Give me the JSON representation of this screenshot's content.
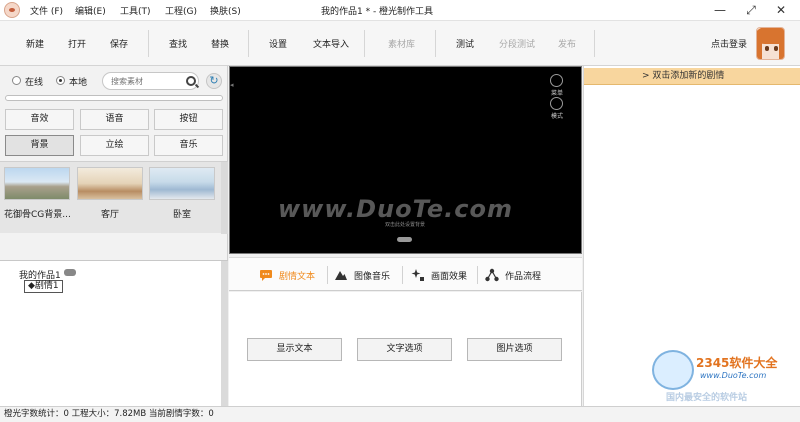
{
  "window": {
    "title": "我的作品1 * - 橙光制作工具",
    "menus": [
      "文件 (F)",
      "编辑(E)",
      "工具(T)",
      "工程(G)",
      "换肤(S)"
    ],
    "controls": {
      "minimize": "—",
      "restore": "⤢",
      "close": "✕"
    }
  },
  "toolbar": {
    "new": "新建",
    "open": "打开",
    "save": "保存",
    "find": "查找",
    "replace": "替换",
    "settings": "设置",
    "import_text": "文本导入",
    "library": "素材库",
    "test": "测试",
    "segment_test": "分段测试",
    "publish": "发布",
    "login": "点击登录"
  },
  "materials": {
    "online_label": "在线",
    "local_label": "本地",
    "selected_source": "本地",
    "search_placeholder": "搜索素材",
    "categories": [
      "音效",
      "语音",
      "按钮",
      "背景",
      "立绘",
      "音乐"
    ],
    "active_category": "背景",
    "thumbnails": [
      {
        "caption": "花御骨CG背景..."
      },
      {
        "caption": "客厅"
      },
      {
        "caption": "卧室"
      }
    ]
  },
  "tree": {
    "root": "我的作品1",
    "node": "◆剧情1"
  },
  "stage": {
    "side_buttons": [
      "菜单",
      "模式"
    ],
    "watermark": "www.DuoTe.com",
    "hint": "双击此处设置背景"
  },
  "tabs": [
    {
      "label": "剧情文本",
      "active": true
    },
    {
      "label": "图像音乐",
      "active": false
    },
    {
      "label": "画面效果",
      "active": false
    },
    {
      "label": "作品流程",
      "active": false
    }
  ],
  "actions": [
    "显示文本",
    "文字选项",
    "图片选项"
  ],
  "right": {
    "header": "> 双击添加新的剧情"
  },
  "corner_logo": {
    "brand": "2345软件大全",
    "url": "www.DuoTe.com",
    "tag": "国内最安全的软件站"
  },
  "status": "橙光字数统计：0  工程大小：7.82MB  当前剧情字数：0",
  "colors": {
    "accent_orange": "#f08a1c",
    "right_header_bg": "#f8d69e",
    "stage_bg": "#000000"
  }
}
